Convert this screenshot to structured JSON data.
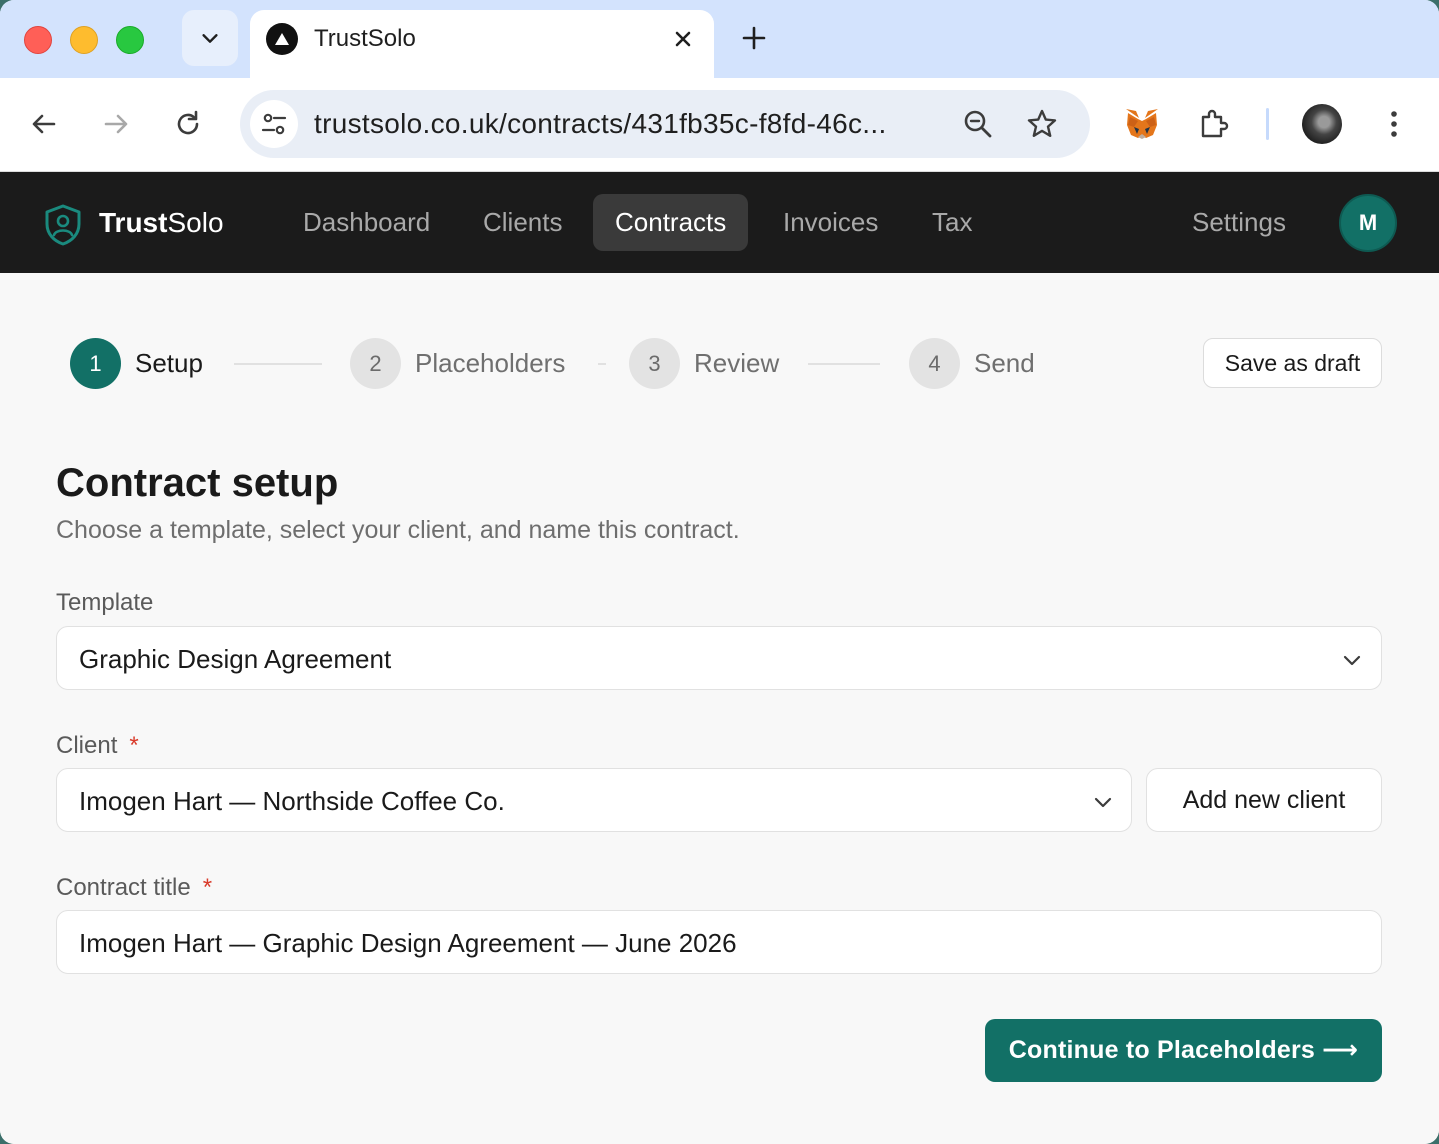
{
  "browser": {
    "tab_title": "TrustSolo",
    "url": "trustsolo.co.uk/contracts/431fb35c-f8fd-46c..."
  },
  "nav": {
    "brand_prefix": "Trust",
    "brand_suffix": "Solo",
    "items": [
      {
        "label": "Dashboard",
        "active": false
      },
      {
        "label": "Clients",
        "active": false
      },
      {
        "label": "Contracts",
        "active": true
      },
      {
        "label": "Invoices",
        "active": false
      },
      {
        "label": "Tax",
        "active": false
      }
    ],
    "settings_label": "Settings",
    "avatar_initial": "M"
  },
  "stepper": {
    "steps": [
      {
        "number": "1",
        "label": "Setup",
        "active": true
      },
      {
        "number": "2",
        "label": "Placeholders",
        "active": false
      },
      {
        "number": "3",
        "label": "Review",
        "active": false
      },
      {
        "number": "4",
        "label": "Send",
        "active": false
      }
    ],
    "save_draft_label": "Save as draft"
  },
  "form": {
    "title": "Contract setup",
    "subtitle": "Choose a template, select your client, and name this contract.",
    "template_label": "Template",
    "template_value": "Graphic Design Agreement",
    "client_label": "Client",
    "client_value": "Imogen Hart — Northside Coffee Co.",
    "add_client_label": "Add new client",
    "contract_title_label": "Contract title",
    "contract_title_value": "Imogen Hart — Graphic Design Agreement — June 2026",
    "required_marker": "*",
    "continue_label": "Continue to Placeholders ⟶"
  },
  "colors": {
    "accent": "#127066",
    "nav_bg": "#1b1b1b",
    "required": "#d93b2b"
  }
}
